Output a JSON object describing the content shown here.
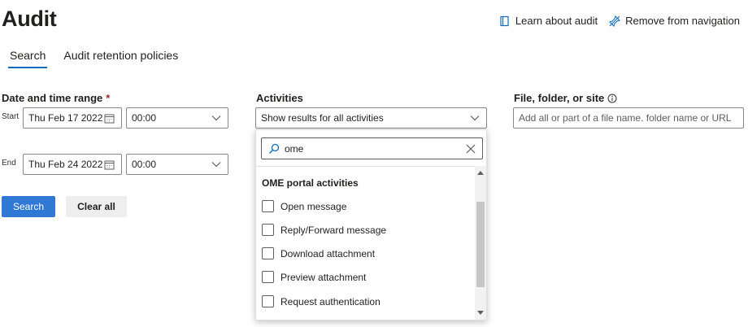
{
  "page": {
    "title": "Audit"
  },
  "top_links": [
    {
      "label": "Learn about audit",
      "icon": "book-icon"
    },
    {
      "label": "Remove from navigation",
      "icon": "unpin-icon"
    }
  ],
  "tabs": [
    {
      "label": "Search",
      "active": true
    },
    {
      "label": "Audit retention policies",
      "active": false
    }
  ],
  "date_range": {
    "label": "Date and time range",
    "required_mark": "*",
    "start_label": "Start",
    "end_label": "End",
    "start_date": "Thu Feb 17 2022",
    "start_time": "00:00",
    "end_date": "Thu Feb 24 2022",
    "end_time": "00:00"
  },
  "activities": {
    "label": "Activities",
    "selected": "Show results for all activities",
    "search_value": "ome",
    "group_header": "OME portal activities",
    "items": [
      {
        "label": "Open message",
        "checked": false
      },
      {
        "label": "Reply/Forward message",
        "checked": false
      },
      {
        "label": "Download attachment",
        "checked": false
      },
      {
        "label": "Preview attachment",
        "checked": false
      },
      {
        "label": "Request authentication",
        "checked": false
      }
    ]
  },
  "file_folder": {
    "label": "File, folder, or site",
    "placeholder": "Add all or part of a file name. folder name or URL"
  },
  "buttons": {
    "search": "Search",
    "clear_all": "Clear all"
  },
  "colors": {
    "primary": "#2f79d5",
    "accent": "#0f6cbd",
    "required": "#a4262c"
  }
}
